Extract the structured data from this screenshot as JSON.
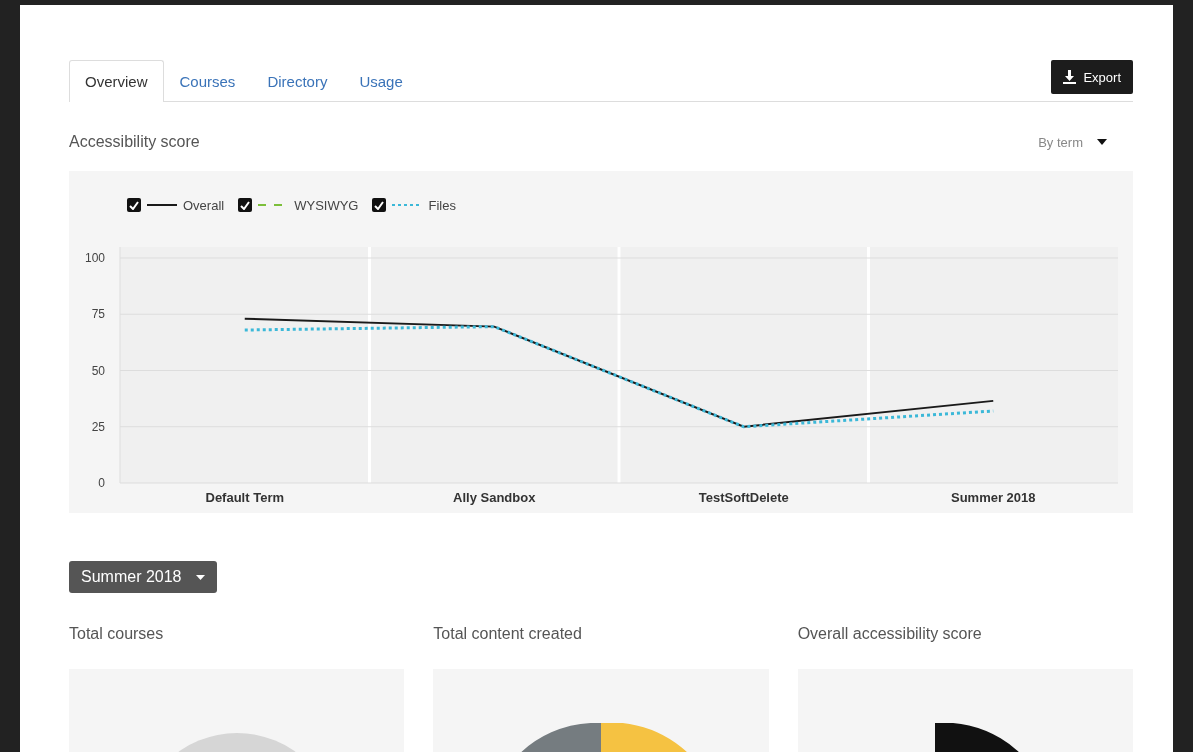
{
  "tabs": [
    {
      "label": "Overview",
      "selected": true
    },
    {
      "label": "Courses",
      "selected": false
    },
    {
      "label": "Directory",
      "selected": false
    },
    {
      "label": "Usage",
      "selected": false
    }
  ],
  "export_button": {
    "label": "Export"
  },
  "accessibility_score": {
    "title": "Accessibility score",
    "period_dropdown": {
      "value": "By term"
    },
    "legend": [
      {
        "checked": true
      },
      {
        "checked": true
      },
      {
        "checked": true
      }
    ],
    "chart_data": {
      "type": "line",
      "grid": true,
      "categories": [
        "Default Term",
        "Ally Sandbox",
        "TestSoftDelete",
        "Summer 2018"
      ],
      "ylim": [
        0,
        100
      ],
      "yticks": [
        0,
        25,
        50,
        75,
        100
      ],
      "series": [
        {
          "name": "Overall",
          "color": "#1a1a1a",
          "line_style": "solid",
          "values": [
            73,
            69.5,
            25,
            36.5
          ]
        },
        {
          "name": "WYSIWYG",
          "color": "#7cbf3a",
          "line_style": "dashed",
          "values": [
            null,
            null,
            null,
            null
          ]
        },
        {
          "name": "Files",
          "color": "#3bb8d8",
          "line_style": "dotted",
          "values": [
            68,
            69.5,
            25,
            32
          ]
        }
      ]
    }
  },
  "term_dropdown": {
    "value": "Summer 2018"
  },
  "cards": [
    {
      "title": "Total courses",
      "kind": "pie"
    },
    {
      "title": "Total content created",
      "kind": "donut"
    },
    {
      "title": "Overall accessibility score",
      "kind": "ring"
    }
  ]
}
